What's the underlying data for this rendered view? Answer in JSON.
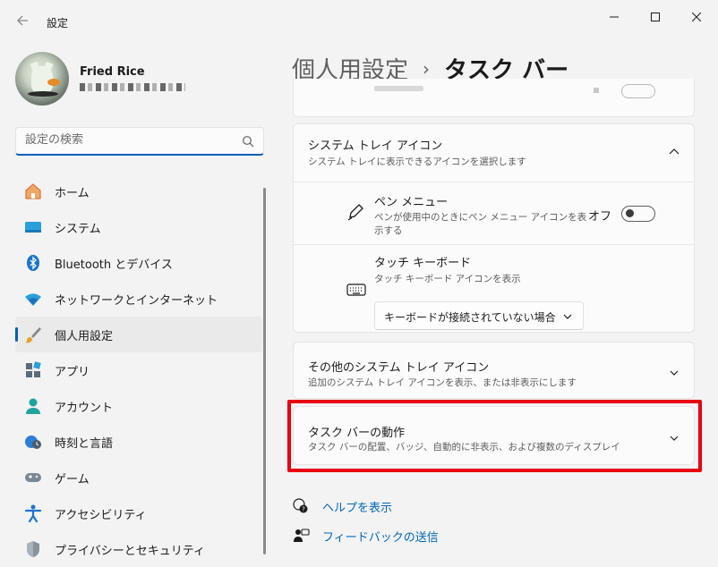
{
  "window": {
    "title": "設定",
    "back_icon": "back-arrow-icon",
    "minimize_icon": "minimize-icon",
    "maximize_icon": "maximize-icon",
    "close_icon": "close-icon"
  },
  "user": {
    "name": "Fried Rice",
    "email": "■■■■■■■■■■"
  },
  "search": {
    "placeholder": "設定の検索",
    "icon": "search-icon"
  },
  "sidebar": {
    "items": [
      {
        "label": "ホーム",
        "icon": "home-icon",
        "active": false
      },
      {
        "label": "システム",
        "icon": "system-icon",
        "active": false
      },
      {
        "label": "Bluetooth とデバイス",
        "icon": "bluetooth-icon",
        "active": false
      },
      {
        "label": "ネットワークとインターネット",
        "icon": "network-icon",
        "active": false
      },
      {
        "label": "個人用設定",
        "icon": "personalization-brush-icon",
        "active": true
      },
      {
        "label": "アプリ",
        "icon": "apps-icon",
        "active": false
      },
      {
        "label": "アカウント",
        "icon": "account-icon",
        "active": false
      },
      {
        "label": "時刻と言語",
        "icon": "time-language-icon",
        "active": false
      },
      {
        "label": "ゲーム",
        "icon": "gaming-icon",
        "active": false
      },
      {
        "label": "アクセシビリティ",
        "icon": "accessibility-icon",
        "active": false
      },
      {
        "label": "プライバシーとセキュリティ",
        "icon": "shield-icon",
        "active": false
      }
    ]
  },
  "breadcrumb": {
    "parent": "個人用設定",
    "separator": "›",
    "current": "タスク バー"
  },
  "system_tray_icons": {
    "title": "システム トレイ アイコン",
    "description": "システム トレイに表示できるアイコンを選択します",
    "pen_menu": {
      "title": "ペン メニュー",
      "description_line1": "ペンが使用中のときにペン メニュー アイコンを表",
      "description_line2": "示する",
      "toggle_state": "オフ",
      "icon": "pen-icon"
    },
    "touch_keyboard": {
      "title": "タッチ キーボード",
      "description": "タッチ キーボード アイコンを表示",
      "dropdown_value": "キーボードが接続されていない場合",
      "icon": "keyboard-icon"
    }
  },
  "other_tray_icons": {
    "title": "その他のシステム トレイ アイコン",
    "description": "追加のシステム トレイ アイコンを表示、または非表示にします"
  },
  "taskbar_behaviors": {
    "title": "タスク バーの動作",
    "description": "タスク バーの配置、バッジ、自動的に非表示、および複数のディスプレイ"
  },
  "links": {
    "help": "ヘルプを表示",
    "feedback": "フィードバックの送信"
  },
  "colors": {
    "accent": "#005fb8",
    "highlight": "#e60012",
    "link": "#0067c0"
  }
}
